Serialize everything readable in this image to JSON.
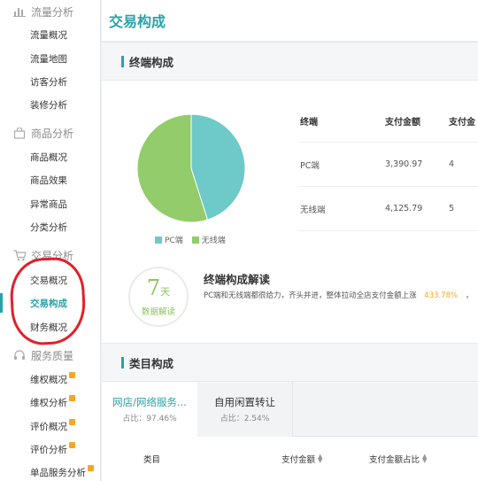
{
  "sidebar": {
    "sections": [
      {
        "title": "流量分析",
        "icon": "bar-chart-icon",
        "items": [
          {
            "label": "流量概况"
          },
          {
            "label": "流量地图"
          },
          {
            "label": "访客分析"
          },
          {
            "label": "装修分析"
          }
        ]
      },
      {
        "title": "商品分析",
        "icon": "shopping-bag-icon",
        "items": [
          {
            "label": "商品概况"
          },
          {
            "label": "商品效果"
          },
          {
            "label": "异常商品"
          },
          {
            "label": "分类分析"
          }
        ]
      },
      {
        "title": "交易分析",
        "icon": "cart-icon",
        "items": [
          {
            "label": "交易概况"
          },
          {
            "label": "交易构成",
            "active": true
          },
          {
            "label": "财务概况"
          }
        ]
      },
      {
        "title": "服务质量",
        "icon": "headset-icon",
        "items": [
          {
            "label": "维权概况"
          },
          {
            "label": "维权分析"
          },
          {
            "label": "评价概况"
          },
          {
            "label": "评价分析"
          },
          {
            "label": "单品服务分析"
          }
        ]
      }
    ]
  },
  "page": {
    "title": "交易构成"
  },
  "terminal": {
    "heading": "终端构成",
    "legend": {
      "pc": "PC端",
      "mobile": "无线端"
    },
    "table": {
      "headers": [
        "终端",
        "支付金额",
        "支付金"
      ],
      "rows": [
        {
          "terminal": "PC端",
          "amount": "3,390.97",
          "share": "4"
        },
        {
          "terminal": "无线端",
          "amount": "4,125.79",
          "share": "5"
        }
      ]
    },
    "interpretation": {
      "badge_number": "7",
      "badge_unit": "天",
      "badge_label": "数据解读",
      "title": "终端构成解读",
      "text": "PC端和无线端都很给力，齐头并进，整体拉动全店支付金额上涨",
      "highlight": "433.78%",
      "tail": "，"
    }
  },
  "category": {
    "heading": "类目构成",
    "tabs": [
      {
        "name": "网店/网络服务...",
        "share": "占比：97.46%",
        "active": true
      },
      {
        "name": "自用闲置转让",
        "share": "占比：2.54%",
        "active": false
      }
    ],
    "headers": {
      "category": "类目",
      "amount": "支付金额",
      "amount_share": "支付金额占比"
    }
  },
  "chart_data": {
    "type": "pie",
    "categories": [
      "PC端",
      "无线端"
    ],
    "values": [
      3390.97,
      4125.79
    ],
    "colors": [
      "#6ec9c9",
      "#93cc6b"
    ]
  },
  "colors": {
    "accent": "#2aa2a9",
    "highlight": "#f5a623",
    "pc": "#6ec9c9",
    "mobile": "#93cc6b",
    "annotation": "#e41e2b"
  }
}
